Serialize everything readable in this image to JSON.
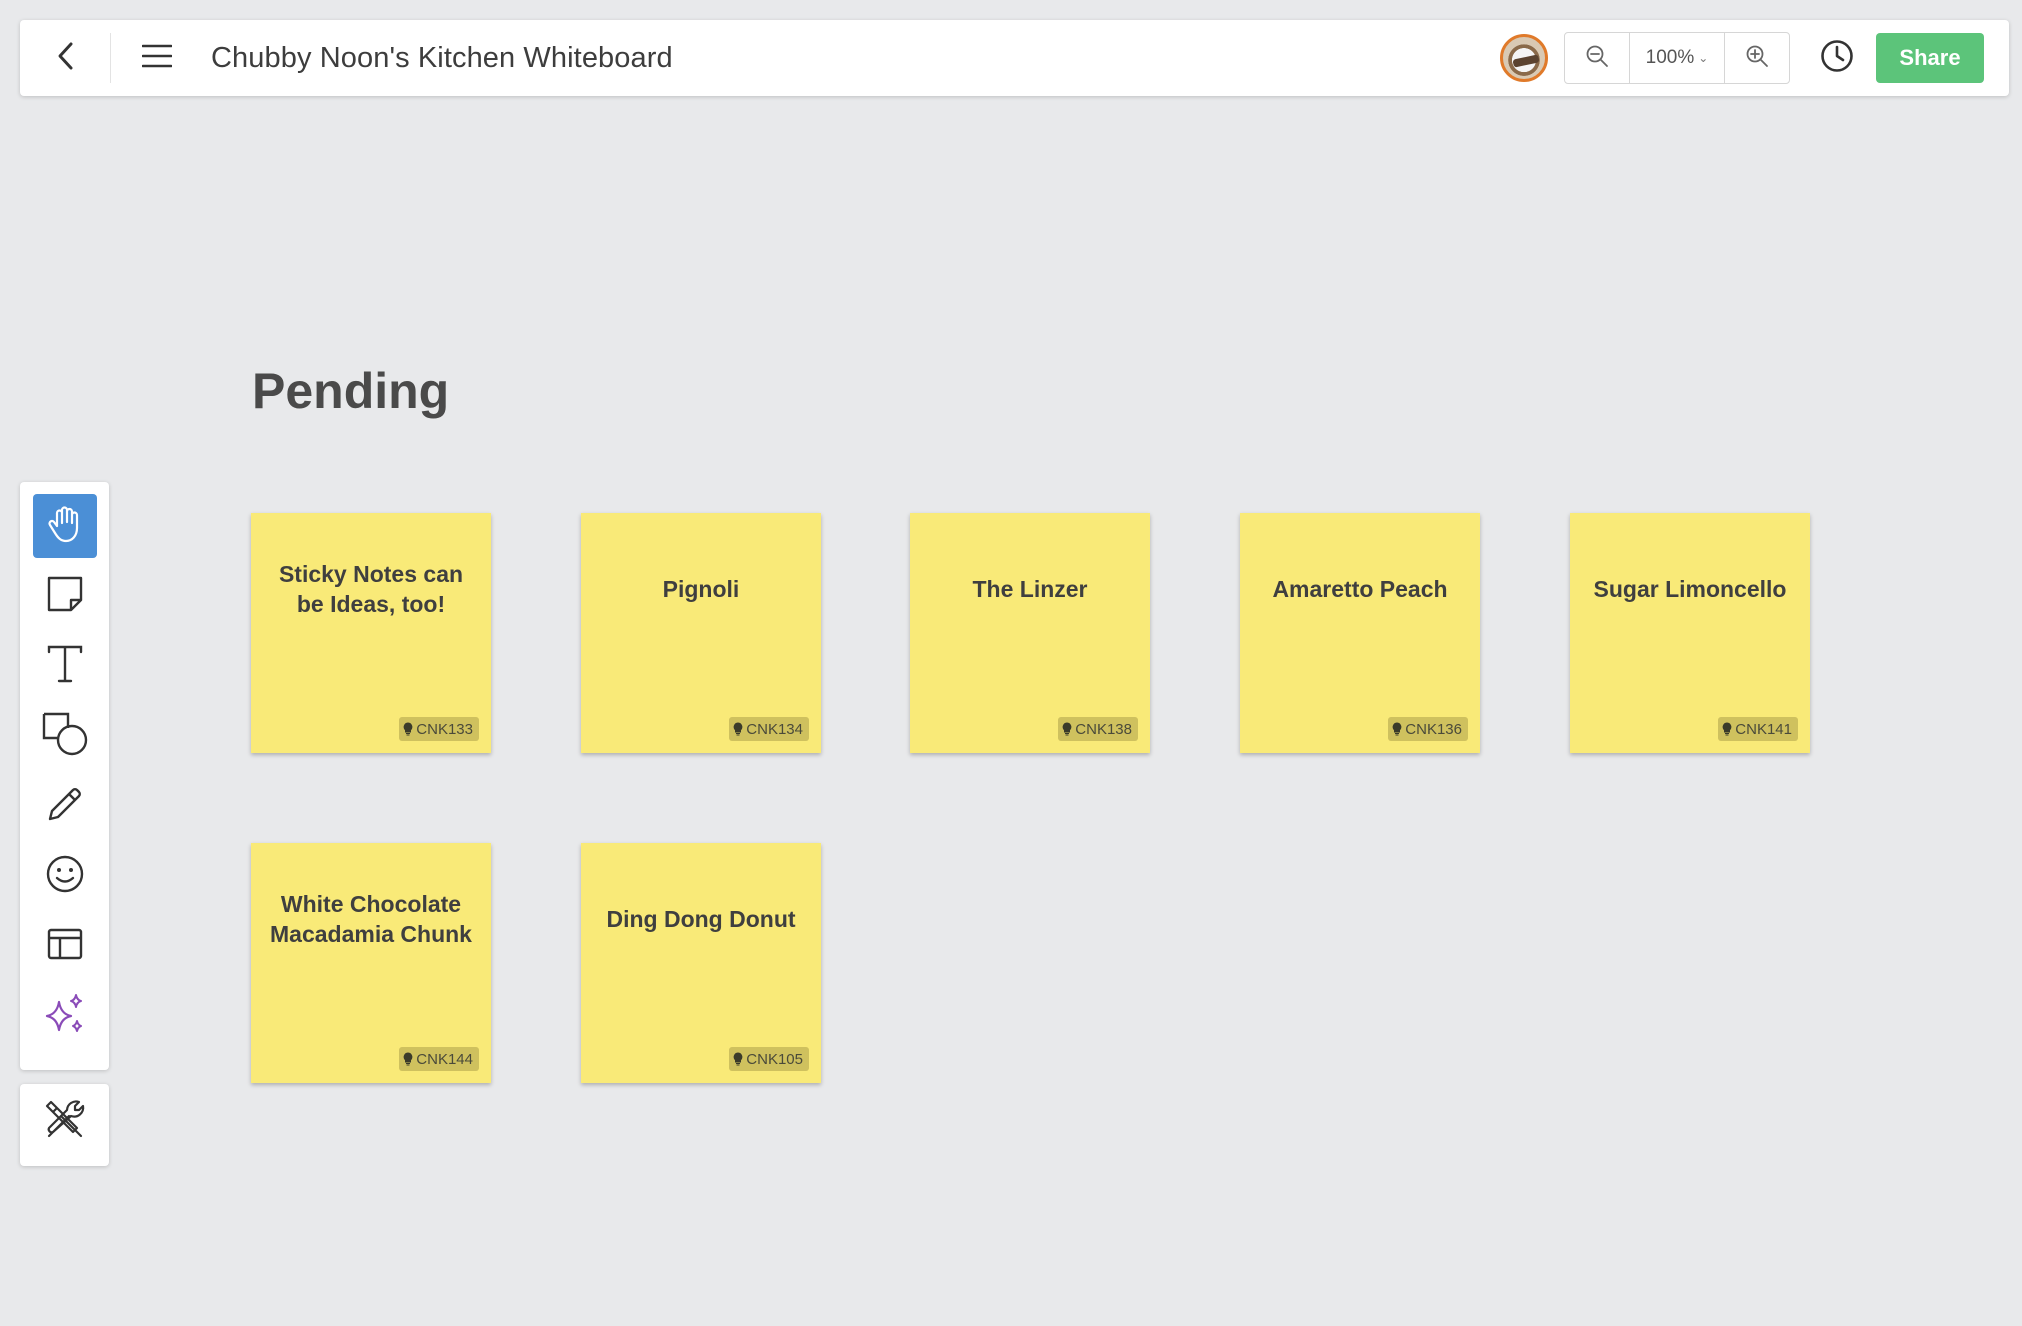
{
  "header": {
    "title": "Chubby Noon's Kitchen Whiteboard",
    "zoom": "100%",
    "share_label": "Share"
  },
  "section": {
    "title": "Pending"
  },
  "toolbar": {
    "tools": [
      "hand-tool",
      "sticky-note-tool",
      "text-tool",
      "shapes-tool",
      "pen-tool",
      "emoji-tool",
      "template-tool",
      "ai-sparkle-tool"
    ],
    "active_tool": "hand-tool",
    "accent_color": "#4b8fd6",
    "sparkle_color": "#8a4bb8"
  },
  "notes": [
    {
      "text": "Sticky Notes can be Ideas, too!",
      "tag": "CNK133"
    },
    {
      "text": "Pignoli",
      "tag": "CNK134"
    },
    {
      "text": "The Linzer",
      "tag": "CNK138"
    },
    {
      "text": "Amaretto Peach",
      "tag": "CNK136"
    },
    {
      "text": "Sugar Limoncello",
      "tag": "CNK141"
    },
    {
      "text": "White Chocolate Macadamia Chunk",
      "tag": "CNK144"
    },
    {
      "text": "Ding Dong Donut",
      "tag": "CNK105"
    }
  ],
  "colors": {
    "canvas": "#e8e9eb",
    "note": "#f9ea78",
    "share": "#5cc47a"
  }
}
